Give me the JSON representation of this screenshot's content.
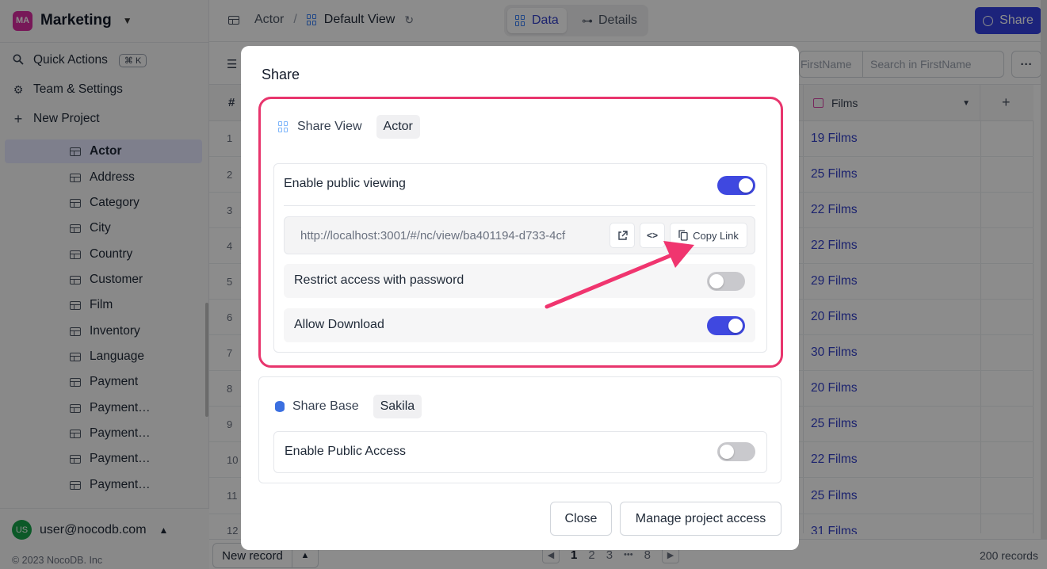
{
  "workspace": {
    "badge": "MA",
    "name": "Marketing"
  },
  "sidebar": {
    "actions": [
      {
        "label": "Quick Actions",
        "shortcut": "⌘ K",
        "icon": "search-icon"
      },
      {
        "label": "Team & Settings",
        "icon": "gear-icon"
      },
      {
        "label": "New Project",
        "icon": "plus-icon"
      }
    ],
    "tables": [
      "Actor",
      "Address",
      "Category",
      "City",
      "Country",
      "Customer",
      "Film",
      "Inventory",
      "Language",
      "Payment",
      "Payment…",
      "Payment…",
      "Payment…",
      "Payment…"
    ],
    "active_table": "Actor",
    "user": {
      "initials": "US",
      "email": "user@nocodb.com"
    },
    "copyright": "© 2023 NocoDB. Inc"
  },
  "topbar": {
    "breadcrumb_table": "Actor",
    "breadcrumb_sep": "/",
    "view_name": "Default View",
    "tabs": [
      "Data",
      "Details"
    ],
    "share_label": "Share"
  },
  "toolbar": {
    "search_field": "FirstName",
    "search_placeholder": "Search in FirstName",
    "more": "···"
  },
  "grid": {
    "hash_header": "#",
    "column_header": "Films",
    "add_column": "+",
    "rows": [
      {
        "n": "1",
        "films": "19 Films"
      },
      {
        "n": "2",
        "films": "25 Films"
      },
      {
        "n": "3",
        "films": "22 Films"
      },
      {
        "n": "4",
        "films": "22 Films"
      },
      {
        "n": "5",
        "films": "29 Films"
      },
      {
        "n": "6",
        "films": "20 Films"
      },
      {
        "n": "7",
        "films": "30 Films"
      },
      {
        "n": "8",
        "films": "20 Films"
      },
      {
        "n": "9",
        "films": "25 Films"
      },
      {
        "n": "10",
        "films": "22 Films"
      },
      {
        "n": "11",
        "films": "25 Films"
      },
      {
        "n": "12",
        "films": "31 Films"
      }
    ],
    "new_record": "New record",
    "pages": [
      "1",
      "2",
      "3",
      "•••",
      "8"
    ],
    "records": "200 records"
  },
  "modal": {
    "title": "Share",
    "share_view": {
      "label": "Share View",
      "chip": "Actor",
      "enable_public_label": "Enable public viewing",
      "enable_public_on": true,
      "url": "http://localhost:3001/#/nc/view/ba401194-d733-4cf",
      "copy_link_label": "Copy Link",
      "restrict_label": "Restrict access with password",
      "restrict_on": false,
      "download_label": "Allow Download",
      "download_on": true
    },
    "share_base": {
      "label": "Share Base",
      "chip": "Sakila",
      "public_access_label": "Enable Public Access",
      "public_access_on": false
    },
    "close_label": "Close",
    "manage_label": "Manage project access"
  },
  "colors": {
    "accent": "#3f48e0",
    "highlight": "#e8356d",
    "link": "#3340c9"
  }
}
